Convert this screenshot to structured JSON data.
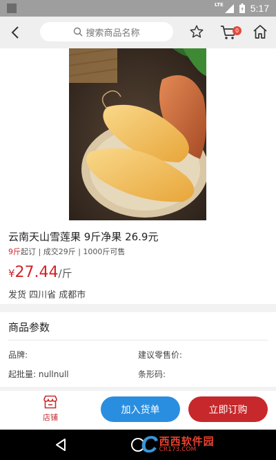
{
  "status_bar": {
    "network": "LTE",
    "time": "5:17"
  },
  "nav": {
    "search_placeholder": "搜索商品名称",
    "cart_count": "0"
  },
  "product": {
    "title": "云南天山雪莲果 9斤净果  26.9元",
    "min_order": "9斤",
    "min_order_suffix": "起订",
    "sold": "成交29斤",
    "stock": "1000斤可售",
    "price_currency": "¥",
    "price": "27.44",
    "price_unit": "/斤",
    "shipping": "发货 四川省 成都市"
  },
  "params": {
    "heading": "商品参数",
    "brand_label": "品牌:",
    "retail_price_label": "建议零售价:",
    "batch_label": "起批量: nullnull",
    "barcode_label": "条形码:"
  },
  "bottom_bar": {
    "shop_label": "店铺",
    "add_to_list_label": "加入货单",
    "buy_now_label": "立即订购"
  },
  "watermark": {
    "brand": "西西软件园",
    "site": "CR173.COM"
  },
  "colors": {
    "accent_red": "#c7282c",
    "accent_blue": "#2a8ee0",
    "price_red": "#d0232a"
  }
}
